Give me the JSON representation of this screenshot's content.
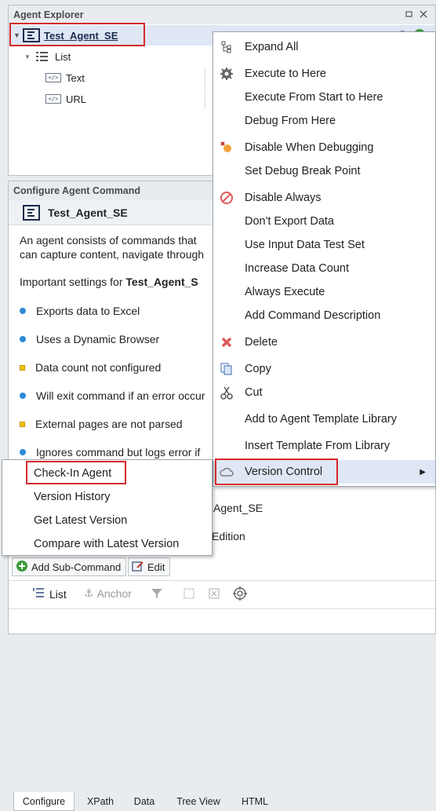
{
  "explorer": {
    "title": "Agent Explorer",
    "tree": {
      "root": "Test_Agent_SE",
      "list": "List",
      "children": [
        "Text",
        "URL"
      ]
    }
  },
  "configure": {
    "title": "Configure Agent Command",
    "agent_name": "Test_Agent_SE",
    "description_line1": "An agent consists of commands that",
    "description_line2": "can capture content, navigate through",
    "important_prefix": "Important settings for ",
    "important_agent": "Test_Agent_S",
    "settings": [
      {
        "text": "Exports data to Excel",
        "level": "info"
      },
      {
        "text": "Uses a Dynamic Browser",
        "level": "info"
      },
      {
        "text": "Data count not configured",
        "level": "warning"
      },
      {
        "text": "Will exit command if an error occur",
        "level": "info"
      },
      {
        "text": "External pages are not parsed",
        "level": "warning"
      },
      {
        "text": "Ignores command but logs error if",
        "level": "info"
      }
    ],
    "lower_name": "Agent_SE",
    "lower_edition": "Edition",
    "buttons": {
      "add_sub_command": "Add Sub-Command",
      "edit": "Edit"
    },
    "toolbar": {
      "list": "List",
      "anchor": "Anchor"
    },
    "tabs": [
      "Configure",
      "XPath",
      "Data",
      "Tree View",
      "HTML"
    ]
  },
  "context_menu": {
    "items": [
      {
        "label": "Expand All",
        "icon": "expand-tree-icon"
      },
      {
        "label": "Execute to Here",
        "icon": "gear-icon"
      },
      {
        "label": "Execute From Start to Here",
        "icon": ""
      },
      {
        "label": "Debug From Here",
        "icon": ""
      },
      {
        "label": "Disable When Debugging",
        "icon": "disable-debug-icon"
      },
      {
        "label": "Set Debug Break Point",
        "icon": ""
      },
      {
        "label": "Disable Always",
        "icon": "prohibited-icon"
      },
      {
        "label": "Don't Export Data",
        "icon": ""
      },
      {
        "label": "Use Input Data Test Set",
        "icon": ""
      },
      {
        "label": "Increase Data Count",
        "icon": ""
      },
      {
        "label": "Always Execute",
        "icon": ""
      },
      {
        "label": "Add Command Description",
        "icon": ""
      },
      {
        "label": "Delete",
        "icon": "delete-x-icon"
      },
      {
        "label": "Copy",
        "icon": "copy-icon"
      },
      {
        "label": "Cut",
        "icon": "scissors-icon"
      },
      {
        "label": "Add to Agent Template Library",
        "icon": ""
      },
      {
        "label": "Insert Template From Library",
        "icon": ""
      },
      {
        "label": "Version Control",
        "icon": "cloud-icon"
      }
    ]
  },
  "submenu": {
    "items": [
      "Check-In Agent",
      "Version History",
      "Get Latest Version",
      "Compare with Latest Version"
    ]
  },
  "colors": {
    "highlight": "#dfe7f5",
    "annotation_red": "#d62a2a",
    "info_dot": "#2e8ad6",
    "warning_square": "#f3c000"
  }
}
